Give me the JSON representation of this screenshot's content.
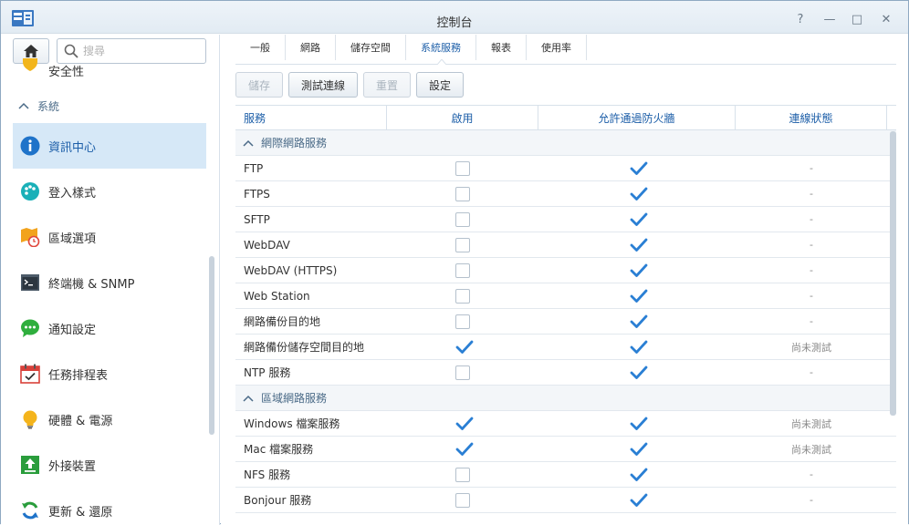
{
  "window": {
    "title": "控制台",
    "help_label": "?",
    "minimize_label": "—",
    "maximize_label": "□",
    "close_label": "✕"
  },
  "sidebar": {
    "search_placeholder": "搜尋",
    "partial_item": "安全性",
    "section_label": "系統",
    "items": [
      {
        "label": "資訊中心",
        "icon": "info-icon",
        "active": true
      },
      {
        "label": "登入樣式",
        "icon": "palette-icon",
        "active": false
      },
      {
        "label": "區域選項",
        "icon": "map-clock-icon",
        "active": false
      },
      {
        "label": "終端機 & SNMP",
        "icon": "terminal-icon",
        "active": false
      },
      {
        "label": "通知設定",
        "icon": "chat-icon",
        "active": false
      },
      {
        "label": "任務排程表",
        "icon": "calendar-icon",
        "active": false
      },
      {
        "label": "硬體 & 電源",
        "icon": "lightbulb-icon",
        "active": false
      },
      {
        "label": "外接裝置",
        "icon": "external-device-icon",
        "active": false
      },
      {
        "label": "更新 & 還原",
        "icon": "refresh-icon",
        "active": false
      }
    ]
  },
  "tabs": [
    {
      "label": "一般",
      "active": false
    },
    {
      "label": "網路",
      "active": false
    },
    {
      "label": "儲存空間",
      "active": false
    },
    {
      "label": "系統服務",
      "active": true
    },
    {
      "label": "報表",
      "active": false
    },
    {
      "label": "使用率",
      "active": false
    }
  ],
  "toolbar": {
    "save_label": "儲存",
    "test_label": "測試連線",
    "reset_label": "重置",
    "settings_label": "設定"
  },
  "grid": {
    "columns": [
      "服務",
      "啟用",
      "允許通過防火牆",
      "連線狀態"
    ],
    "rows": [
      {
        "type": "group",
        "label": "網際網路服務"
      },
      {
        "type": "row",
        "service": "FTP",
        "enabled": false,
        "firewall": true,
        "status": "-"
      },
      {
        "type": "row",
        "service": "FTPS",
        "enabled": false,
        "firewall": true,
        "status": "-"
      },
      {
        "type": "row",
        "service": "SFTP",
        "enabled": false,
        "firewall": true,
        "status": "-"
      },
      {
        "type": "row",
        "service": "WebDAV",
        "enabled": false,
        "firewall": true,
        "status": "-"
      },
      {
        "type": "row",
        "service": "WebDAV (HTTPS)",
        "enabled": false,
        "firewall": true,
        "status": "-"
      },
      {
        "type": "row",
        "service": "Web Station",
        "enabled": false,
        "firewall": true,
        "status": "-"
      },
      {
        "type": "row",
        "service": "網路備份目的地",
        "enabled": false,
        "firewall": true,
        "status": "-"
      },
      {
        "type": "row",
        "service": "網路備份儲存空間目的地",
        "enabled": true,
        "firewall": true,
        "status": "尚未測試"
      },
      {
        "type": "row",
        "service": "NTP 服務",
        "enabled": false,
        "firewall": true,
        "status": "-"
      },
      {
        "type": "group",
        "label": "區域網路服務"
      },
      {
        "type": "row",
        "service": "Windows 檔案服務",
        "enabled": true,
        "firewall": true,
        "status": "尚未測試"
      },
      {
        "type": "row",
        "service": "Mac 檔案服務",
        "enabled": true,
        "firewall": true,
        "status": "尚未測試"
      },
      {
        "type": "row",
        "service": "NFS 服務",
        "enabled": false,
        "firewall": true,
        "status": "-"
      },
      {
        "type": "row",
        "service": "Bonjour 服務",
        "enabled": false,
        "firewall": true,
        "status": "-"
      }
    ]
  },
  "colors": {
    "accent": "#1c5ea8",
    "checkmark": "#2a7fd4",
    "active_bg": "#d6e8f7"
  }
}
